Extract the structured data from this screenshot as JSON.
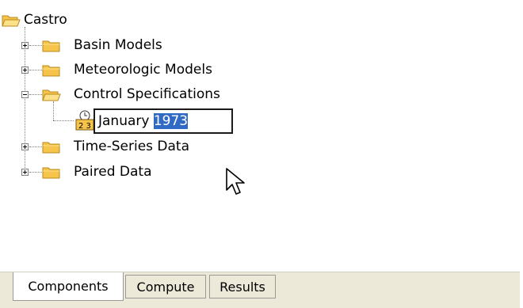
{
  "tree": {
    "root": {
      "label": "Castro",
      "icon": "folder-open-icon"
    },
    "items": [
      {
        "label": "Basin Models",
        "expander": "plus",
        "icon": "folder-icon"
      },
      {
        "label": "Meteorologic Models",
        "expander": "plus",
        "icon": "folder-icon"
      },
      {
        "label": "Control Specifications",
        "expander": "minus",
        "icon": "folder-open-icon"
      },
      {
        "label": "Time-Series Data",
        "expander": "plus",
        "icon": "folder-icon"
      },
      {
        "label": "Paired Data",
        "expander": "plus",
        "icon": "folder-icon"
      }
    ],
    "edit": {
      "icon": "control-spec-icon",
      "icon_text": "2 3",
      "value_plain": "January ",
      "value_selected": "1973"
    }
  },
  "tabs": [
    {
      "label": "Components",
      "active": true
    },
    {
      "label": "Compute",
      "active": false
    },
    {
      "label": "Results",
      "active": false
    }
  ],
  "colors": {
    "folder": "#f6c44b",
    "folder_edge": "#b88a1b",
    "selection": "#316ac5",
    "tabbar": "#ece9d8"
  }
}
